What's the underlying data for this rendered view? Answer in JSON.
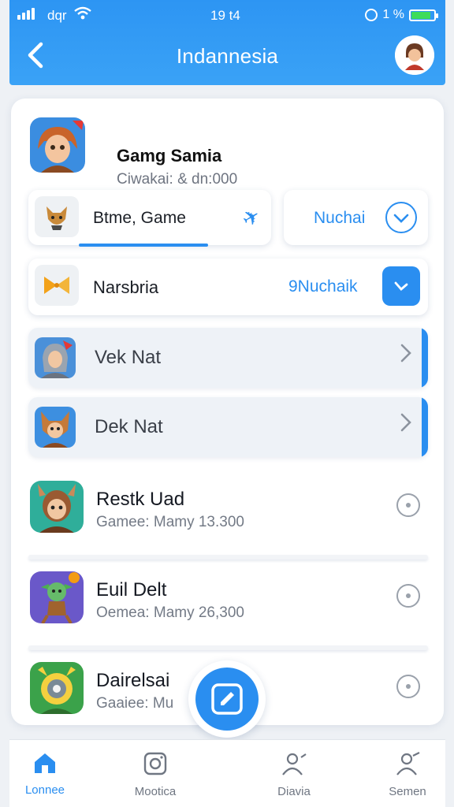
{
  "status_bar": {
    "carrier": "dqr",
    "time": "19 t4",
    "right_text": "1 %"
  },
  "header": {
    "title": "Indannesia",
    "back_icon": "chevron-left-icon",
    "avatar_icon": "user-avatar"
  },
  "top_game": {
    "name": "Gamg Samia",
    "subtitle": "Ciwakai: & dn:000"
  },
  "filters": {
    "game_pill_label": "Btme, Game",
    "game_pill_icon": "plane-icon",
    "nuchai_label": "Nuchai",
    "row_label": "Narsbria",
    "row_right_label": "9Nuchaik"
  },
  "selectable_rows": [
    {
      "label": "Vek Nat"
    },
    {
      "label": "Dek Nat"
    }
  ],
  "game_list": [
    {
      "name": "Restk Uad",
      "subtitle": "Gamee: Mamy 13.300"
    },
    {
      "name": "Euil Delt",
      "subtitle": "Oemea: Mamy 26,300"
    },
    {
      "name": "Dairelsai",
      "subtitle": "Gaaiee: Mu"
    }
  ],
  "bottom_nav": [
    {
      "label": "Lonnee",
      "icon": "home-icon",
      "active": true
    },
    {
      "label": "Mootica",
      "icon": "camera-icon",
      "active": false
    },
    {
      "label": "Diavia",
      "icon": "user-icon",
      "active": false
    },
    {
      "label": "Semen",
      "icon": "profile-icon",
      "active": false
    }
  ],
  "colors": {
    "accent": "#2a8ef0",
    "header": "#3aa2f6",
    "background": "#eef1f5"
  }
}
